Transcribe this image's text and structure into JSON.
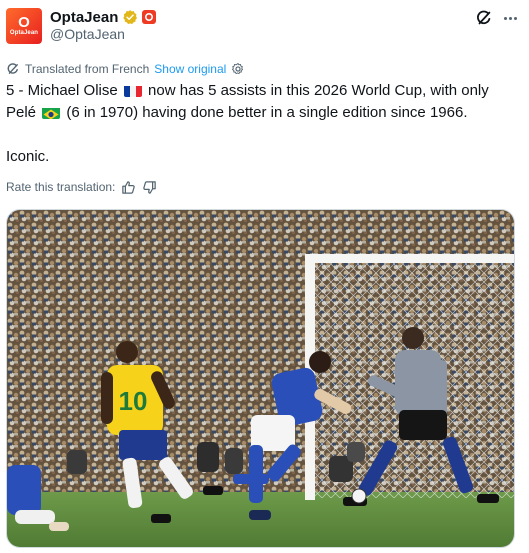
{
  "author": {
    "avatar_top": "O",
    "avatar_bottom": "OptaJean",
    "display_name": "OptaJean",
    "handle": "@OptaJean",
    "verified_color": "#e2b719",
    "affiliation_color": "#ef3b24"
  },
  "header_actions": {
    "grok_icon": "grok-icon",
    "more_icon": "more-icon"
  },
  "translation": {
    "label": "Translated from French",
    "show_original": "Show original",
    "settings_icon": "gear-icon"
  },
  "tweet": {
    "line1_a": "5 - Michael Olise ",
    "line1_b": " now has 5 assists in this 2026 World Cup, with only",
    "line2_a": "Pelé ",
    "line2_b": " (6 in 1970) having done better in a single edition since 1966.",
    "line3": "Iconic.",
    "flag1": "France",
    "flag2": "Brazil"
  },
  "rating": {
    "label": "Rate this translation:",
    "up_icon": "thumbs-up-icon",
    "down_icon": "thumbs-down-icon"
  },
  "media": {
    "jersey_number": "10"
  },
  "colors": {
    "accent": "#1d9bf0",
    "text": "#0f1419",
    "secondary": "#536471",
    "brazil_yellow": "#f6d21b",
    "italy_blue": "#2a4fb8"
  }
}
